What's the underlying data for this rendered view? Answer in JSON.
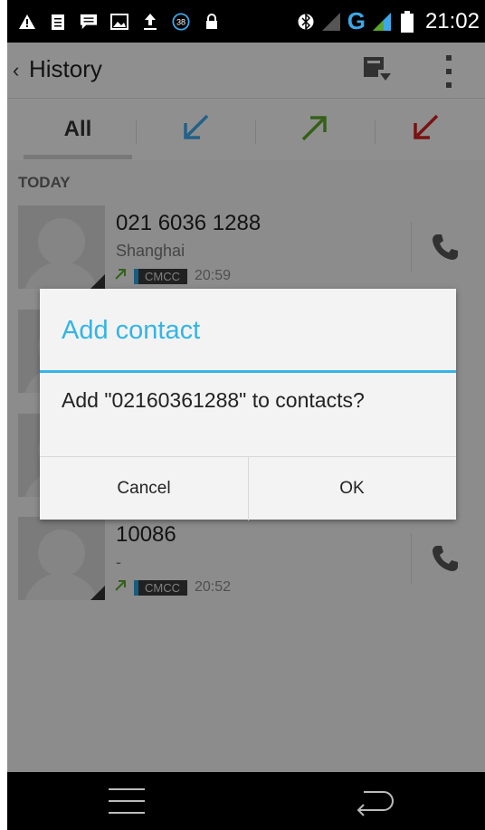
{
  "status_bar": {
    "time": "21:02",
    "network": "G",
    "notification_badge": "38",
    "icons": [
      "warning-icon",
      "clipboard-icon",
      "message-icon",
      "image-icon",
      "upload-icon",
      "badge-38-icon",
      "lock-icon",
      "bluetooth-icon",
      "signal-icon",
      "battery-icon"
    ]
  },
  "action_bar": {
    "back_glyph": "‹",
    "title": "History",
    "action_icon": "save-contact-icon",
    "overflow_icon": "overflow-menu-icon"
  },
  "tabs": [
    {
      "label": "All",
      "selected": true
    },
    {
      "icon": "incoming-call-icon",
      "color": "#3da7e8"
    },
    {
      "icon": "outgoing-call-icon",
      "color": "#5aa62b"
    },
    {
      "icon": "missed-call-icon",
      "color": "#d02020"
    }
  ],
  "section_header": "TODAY",
  "calls": [
    {
      "number": "021 6036 1288",
      "location": "Shanghai",
      "sim": "CMCC",
      "time": "20:59",
      "direction": "outgoing"
    },
    {
      "number": "10086",
      "location": "-",
      "sim": "CMCC",
      "time": "20:52",
      "direction": "outgoing"
    }
  ],
  "dialog": {
    "title": "Add contact",
    "message": "Add \"02160361288\" to contacts?",
    "cancel_label": "Cancel",
    "ok_label": "OK",
    "accent_color": "#33b5e5"
  },
  "nav_bar": {
    "icons": [
      "menu-icon",
      "back-icon"
    ]
  }
}
